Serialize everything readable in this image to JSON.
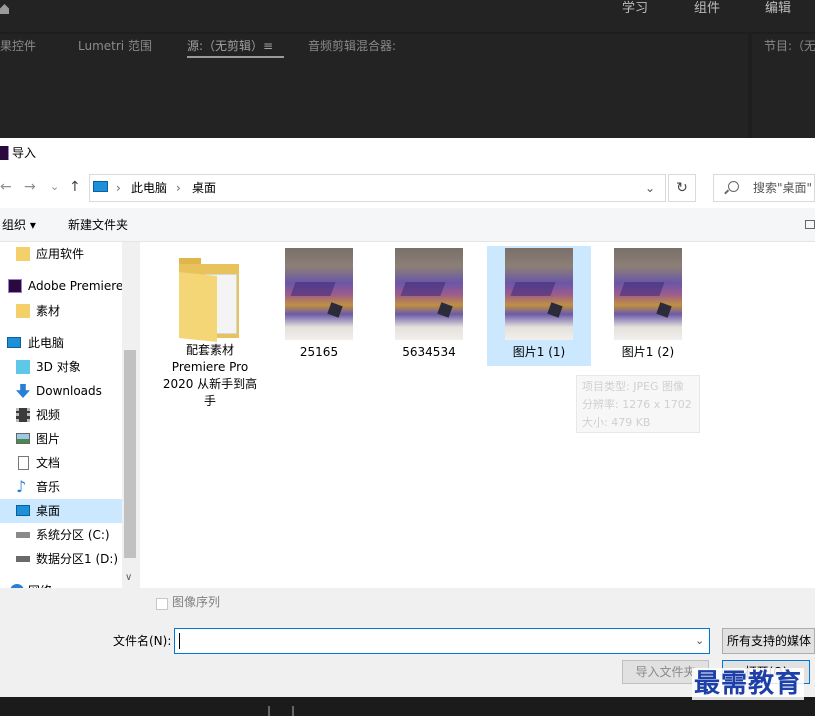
{
  "premiere": {
    "workspaces": [
      "学习",
      "组件",
      "编辑"
    ],
    "panel_tabs": {
      "effect_controls": "果控件",
      "lumetri": "Lumetri 范围",
      "source": "源:（无剪辑）",
      "source_menu": "≡",
      "audio_mixer": "音频剪辑混合器:",
      "program": "节目:（无"
    }
  },
  "dialog": {
    "title": "导入",
    "app_icon_text": "Pr",
    "nav": {
      "back": "←",
      "forward": "→",
      "recent": "⌄",
      "up": "↑"
    },
    "address": {
      "segments": [
        "此电脑",
        "桌面"
      ],
      "sep": "›",
      "dropdown": "⌄"
    },
    "refresh": "↻",
    "search": {
      "placeholder": "搜索\"桌面\""
    },
    "toolbar": {
      "organize": "组织 ▾",
      "new_folder": "新建文件夹"
    },
    "nav_pane": {
      "items": [
        {
          "label": "应用软件",
          "icon": "folder-icon"
        },
        {
          "label": "Adobe Premiere",
          "icon": "premiere-icon"
        },
        {
          "label": "素材",
          "icon": "folder-icon"
        },
        {
          "label": "此电脑",
          "icon": "computer-icon"
        },
        {
          "label": "3D 对象",
          "icon": "cube-icon"
        },
        {
          "label": "Downloads",
          "icon": "download-icon"
        },
        {
          "label": "视频",
          "icon": "video-icon"
        },
        {
          "label": "图片",
          "icon": "picture-icon"
        },
        {
          "label": "文档",
          "icon": "document-icon"
        },
        {
          "label": "音乐",
          "icon": "music-icon"
        },
        {
          "label": "桌面",
          "icon": "desktop-icon"
        },
        {
          "label": "系统分区 (C:)",
          "icon": "drive-icon"
        },
        {
          "label": "数据分区1 (D:)",
          "icon": "drive-icon"
        },
        {
          "label": "网络",
          "icon": "network-icon"
        }
      ],
      "selected": "桌面"
    },
    "files": [
      {
        "name": "配套素材 Premiere Pro 2020 从新手到高手",
        "type": "folder"
      },
      {
        "name": "25165",
        "type": "image"
      },
      {
        "name": "5634534",
        "type": "image"
      },
      {
        "name": "图片1 (1)",
        "type": "image",
        "selected": true
      },
      {
        "name": "图片1 (2)",
        "type": "image"
      }
    ],
    "tooltip": {
      "line1": "项目类型: JPEG 图像",
      "line2": "分辨率: 1276 x 1702",
      "line3": "大小: 479 KB"
    },
    "image_sequence_label": "图像序列",
    "filename_label": "文件名(N):",
    "filename_value": "",
    "filetype": "所有支持的媒体",
    "import_folder_button": "导入文件夹",
    "open_button": "打开(O)"
  },
  "watermark": "最需教育"
}
